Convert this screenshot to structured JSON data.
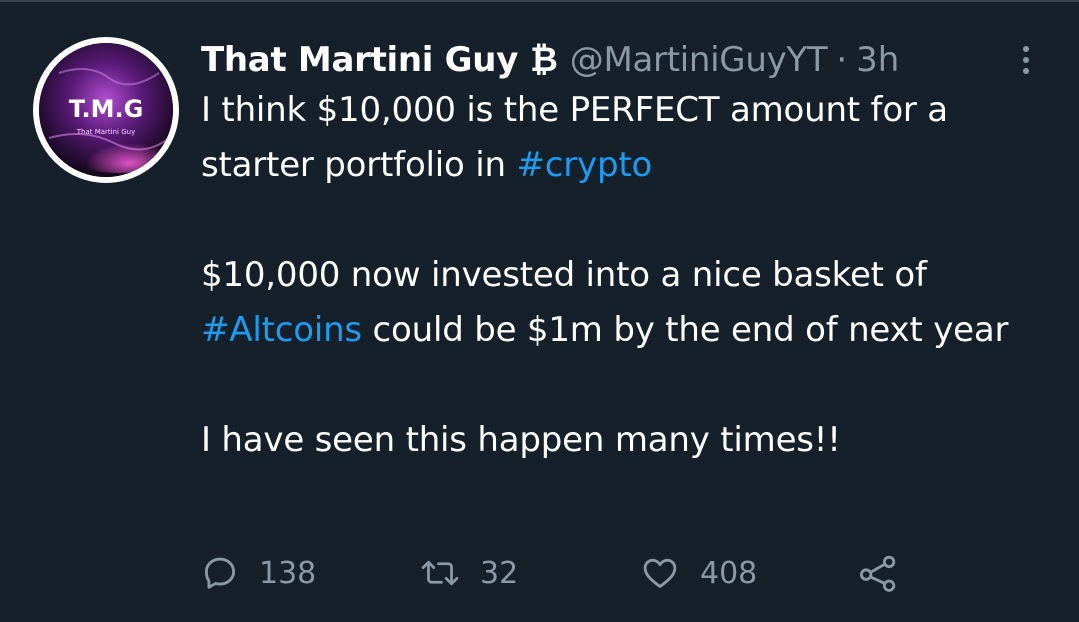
{
  "tweet": {
    "author_name": "That Martini Guy",
    "author_badge": "₿",
    "handle": "@MartiniGuyYT",
    "separator": "·",
    "time": "3h",
    "avatar": {
      "initials": "T.M.G",
      "subtitle": "That Martini Guy"
    },
    "text": {
      "l1_a": "I think $10,000 is the PERFECT amount for a starter portfolio in ",
      "l1_tag": "#crypto",
      "l2_a": "$10,000 now invested into a nice basket of ",
      "l2_tag": "#Altcoins",
      "l2_b": " could be $1m by the end of next year",
      "l3": "I have seen this happen many times!!"
    },
    "stats": {
      "replies": "138",
      "retweets": "32",
      "likes": "408"
    }
  },
  "colors": {
    "background": "#15202b",
    "text": "#ffffff",
    "muted": "#8b98a5",
    "link": "#1d9bf0"
  },
  "icons": {
    "more": "more-vertical-icon",
    "reply": "reply-icon",
    "retweet": "retweet-icon",
    "like": "heart-icon",
    "share": "share-icon"
  }
}
